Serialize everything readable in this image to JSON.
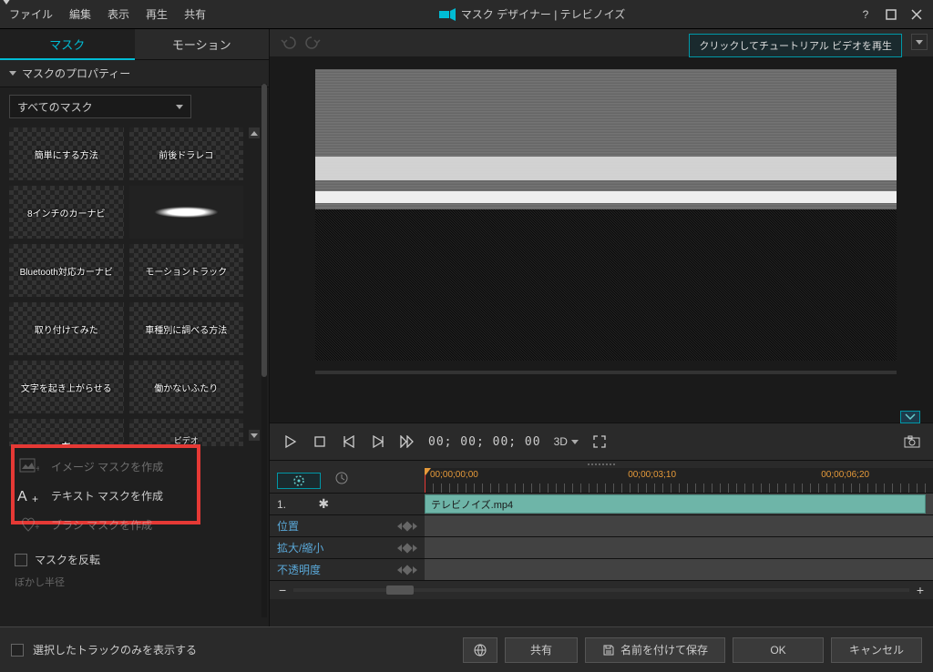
{
  "menubar": {
    "file": "ファイル",
    "edit": "編集",
    "view": "表示",
    "play": "再生",
    "share": "共有",
    "title": "マスク デザイナー  |  テレビノイズ"
  },
  "tabs": {
    "mask": "マスク",
    "motion": "モーション"
  },
  "prop": {
    "header": "マスクのプロパティー",
    "filter": "すべてのマスク",
    "items": [
      "簡単にする方法",
      "前後ドラレコ",
      "8インチのカーナビ",
      "",
      "Bluetooth対応カーナビ",
      "モーショントラック",
      "取り付けてみた",
      "車種別に調べる方法",
      "文字を起き上がらせる",
      "働かないふたり",
      "",
      ""
    ],
    "create_image": "イメージ マスクを作成",
    "create_text": "テキスト マスクを作成",
    "create_brush": "ブラシ マスクを作成",
    "invert": "マスクを反転",
    "blur": "ぼかし半径"
  },
  "preview": {
    "tutorial": "クリックしてチュートリアル ビデオを再生",
    "timecode": "00; 00; 00; 00",
    "three_d": "3D"
  },
  "timeline": {
    "ruler": [
      "00;00;00;00",
      "00;00;03;10",
      "00;00;06;20"
    ],
    "track_label": "1.",
    "clip_name": "テレビノイズ.mp4",
    "rows": [
      "位置",
      "拡大/縮小",
      "不透明度"
    ]
  },
  "bottom": {
    "show_selected": "選択したトラックのみを表示する",
    "share": "共有",
    "save_as": "名前を付けて保存",
    "ok": "OK",
    "cancel": "キャンセル"
  }
}
